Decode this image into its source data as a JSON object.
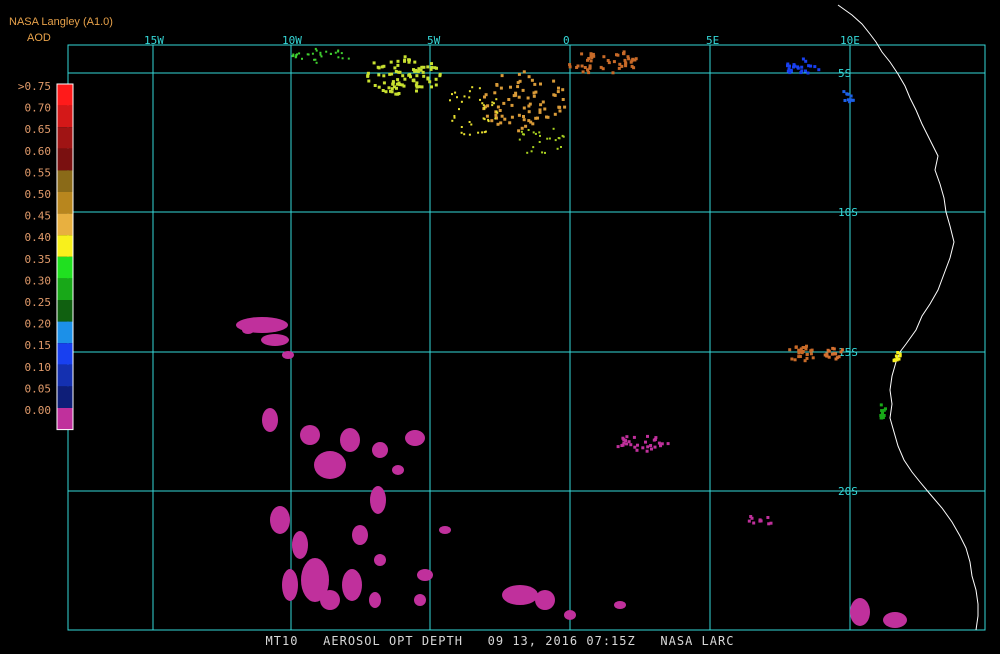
{
  "header": {
    "title": "NASA Langley (A1.0)",
    "subtitle": "AOD"
  },
  "colorbar": {
    "labels": [
      ">0.75",
      "0.70",
      "0.65",
      "0.60",
      "0.55",
      "0.50",
      "0.45",
      "0.40",
      "0.35",
      "0.30",
      "0.25",
      "0.20",
      "0.15",
      "0.10",
      "0.05",
      "0.00"
    ],
    "colors": [
      "#ff1a1a",
      "#d41818",
      "#a01414",
      "#7a1010",
      "#8a6a18",
      "#b8861e",
      "#e8b040",
      "#f8f01c",
      "#20e020",
      "#18a818",
      "#106010",
      "#1c90e8",
      "#1840f0",
      "#1430b0",
      "#0e1e78",
      "#c0309c"
    ]
  },
  "grid": {
    "lon_labels": [
      "15W",
      "10W",
      "5W",
      "0",
      "5E",
      "10E"
    ],
    "lat_labels": [
      "5S",
      "10S",
      "15S",
      "20S"
    ]
  },
  "footer": {
    "product": "MT10",
    "parameter": "AEROSOL OPT DEPTH",
    "date": "09 13, 2016",
    "time": "07:15Z",
    "source": "NASA LARC"
  }
}
